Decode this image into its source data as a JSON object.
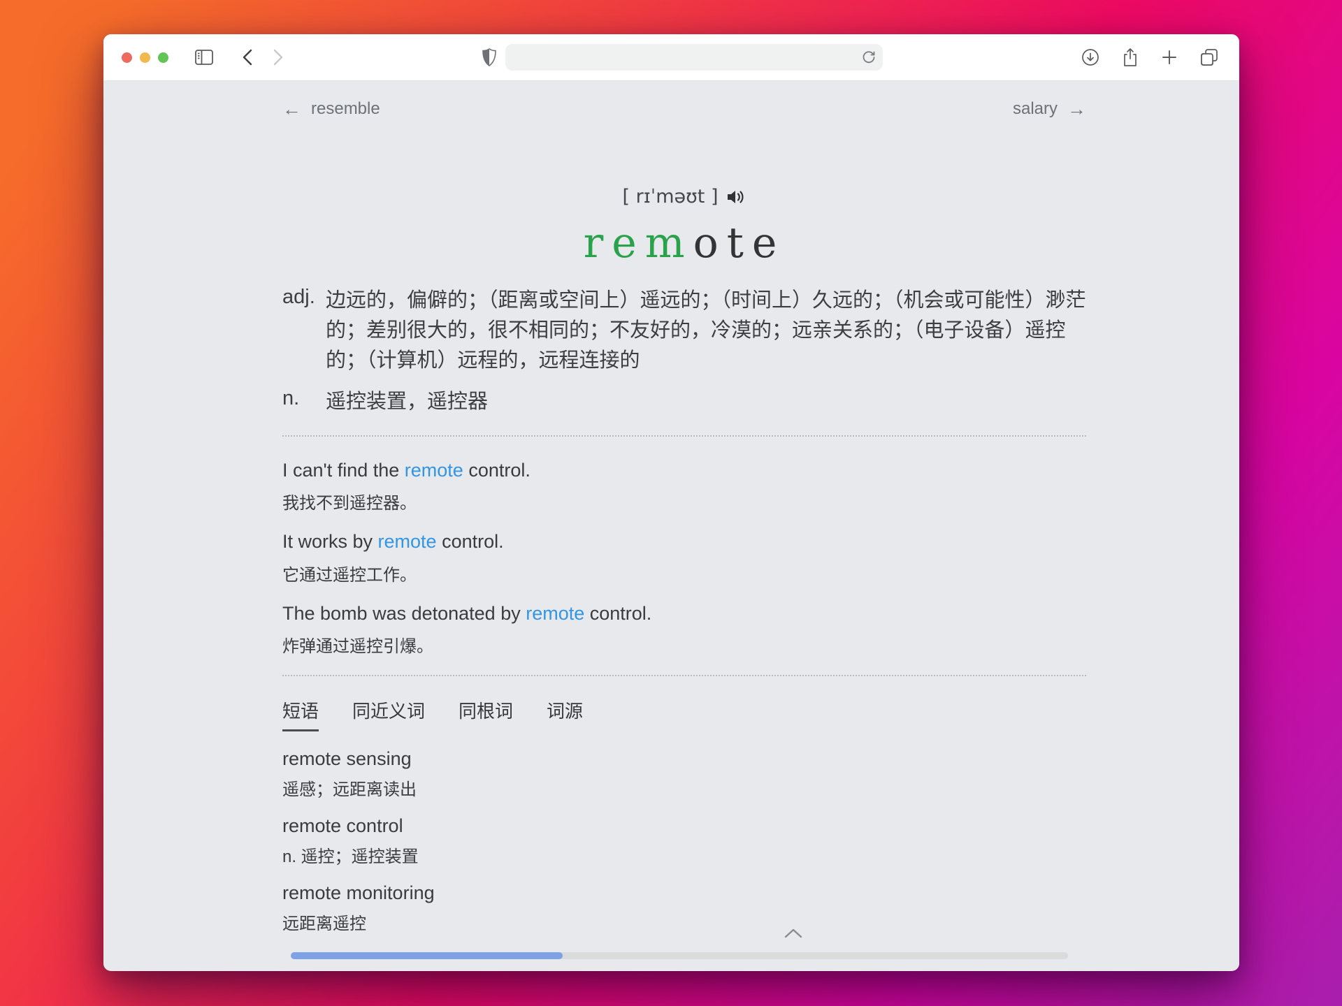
{
  "toolbar": {
    "address_value": "",
    "icons": [
      "sidebar-toggle-icon",
      "back-icon",
      "forward-icon",
      "privacy-shield-icon",
      "refresh-icon",
      "download-icon",
      "share-icon",
      "new-tab-icon",
      "tab-overview-icon"
    ]
  },
  "nav": {
    "prev_label": "resemble",
    "next_label": "salary",
    "prev_arrow": "←",
    "next_arrow": "→"
  },
  "head": {
    "phonetic": "[ rɪˈməʊt ]",
    "word_green": "rem",
    "word_rest": "ote"
  },
  "definitions": [
    {
      "pos": "adj.",
      "text": "边远的，偏僻的；（距离或空间上）遥远的；（时间上）久远的；（机会或可能性）渺茫的；差别很大的，很不相同的；不友好的，冷漠的；远亲关系的；（电子设备）遥控的；（计算机）远程的，远程连接的"
    },
    {
      "pos": "n.",
      "text": "遥控装置，遥控器"
    }
  ],
  "examples": [
    {
      "en_before": "I can't find the ",
      "en_highlight": "remote",
      "en_after": " control.",
      "cn": "我找不到遥控器。"
    },
    {
      "en_before": "It works by ",
      "en_highlight": "remote",
      "en_after": " control.",
      "cn": "它通过遥控工作。"
    },
    {
      "en_before": "The bomb was detonated by ",
      "en_highlight": "remote",
      "en_after": " control.",
      "cn": "炸弹通过遥控引爆。"
    }
  ],
  "tabs": [
    {
      "label": "短语",
      "active": true
    },
    {
      "label": "同近义词",
      "active": false
    },
    {
      "label": "同根词",
      "active": false
    },
    {
      "label": "词源",
      "active": false
    }
  ],
  "phrases": [
    {
      "en": "remote sensing",
      "cn": "遥感；远距离读出"
    },
    {
      "en": "remote control",
      "cn": "n. 遥控；遥控装置"
    },
    {
      "en": "remote monitoring",
      "cn": "远距离遥控"
    }
  ],
  "scrollbar": {
    "progress_percent": 35
  },
  "colors": {
    "word_green": "#2aa24c",
    "link_blue": "#3296e4",
    "scroll_thumb_blue": "#7fa1e5",
    "traffic_red": "#ec6a5e",
    "traffic_yellow": "#f0b84f",
    "traffic_green": "#61c454",
    "background_gradient": [
      "#f66c2a",
      "#ee0a62",
      "#a81fae"
    ]
  }
}
